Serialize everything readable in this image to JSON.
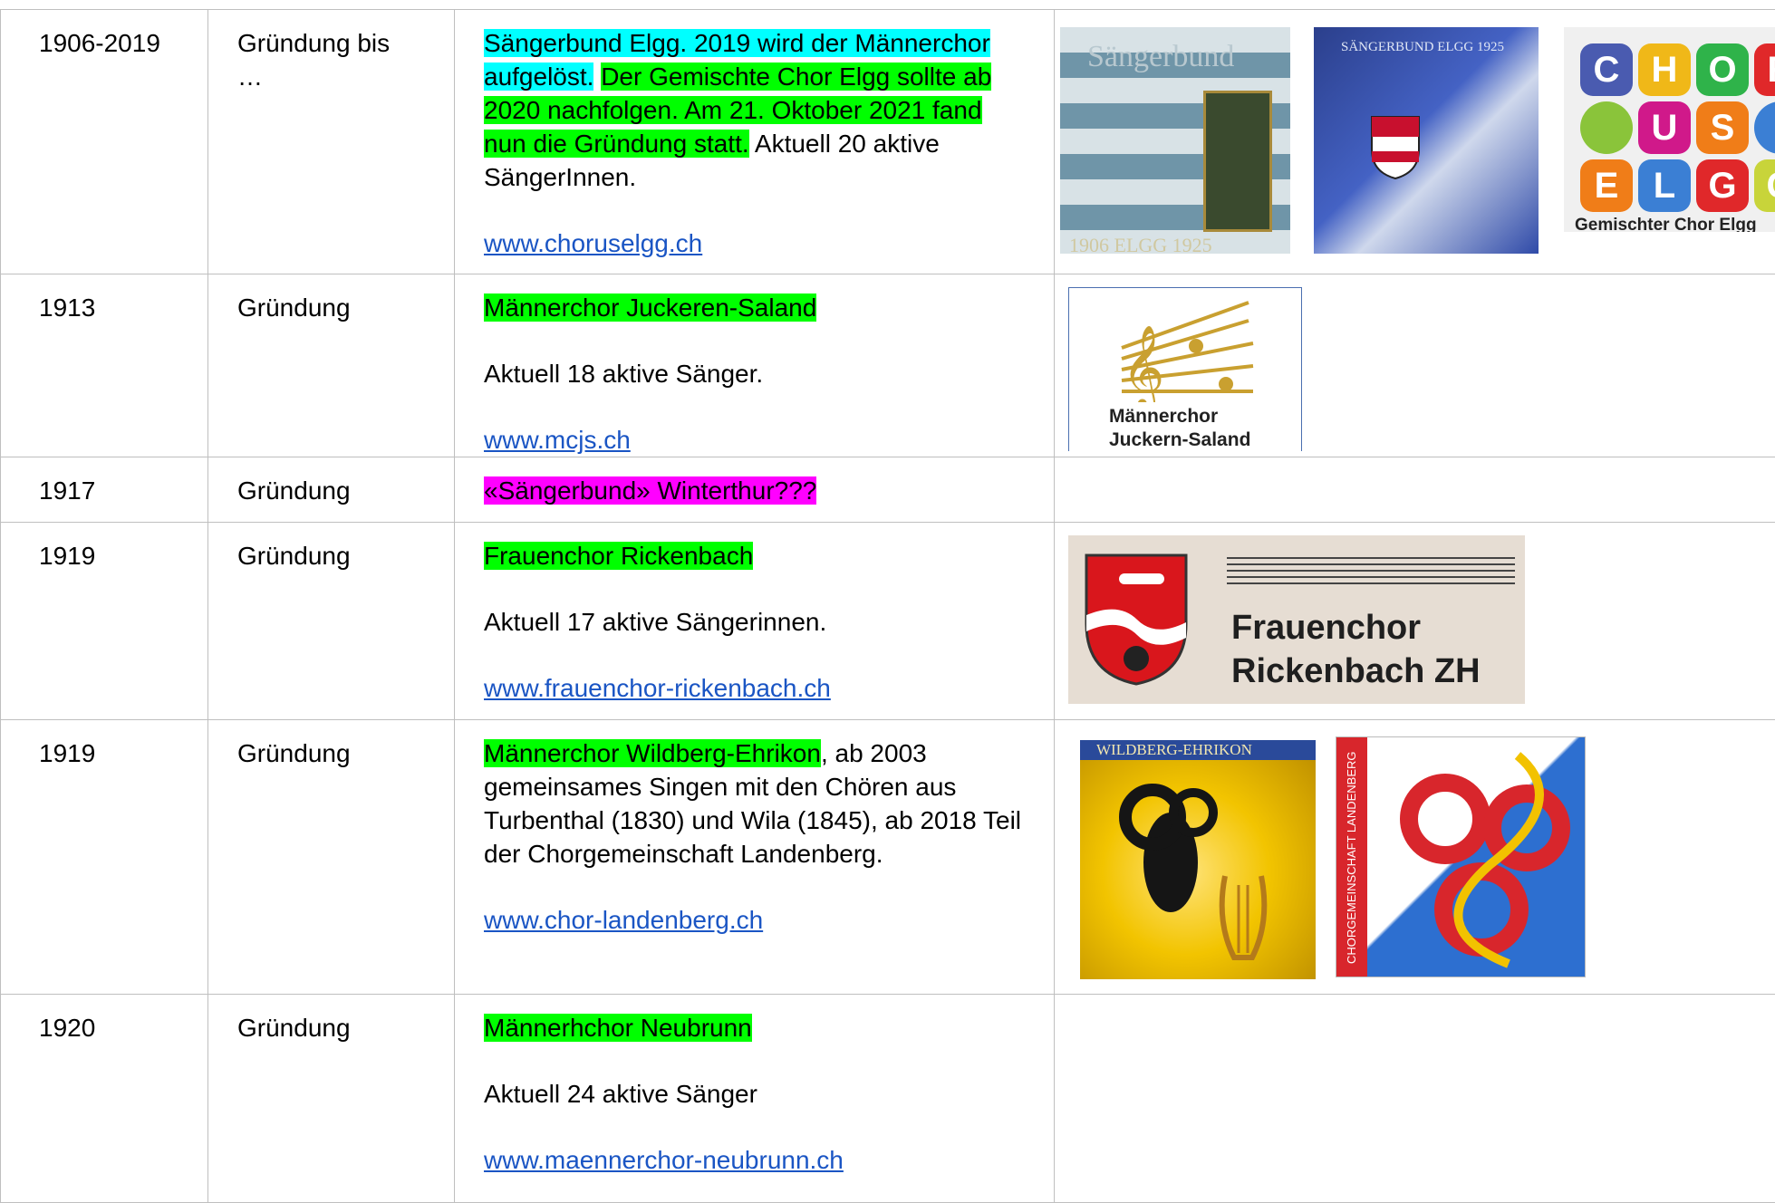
{
  "rows": [
    {
      "year": "1906-2019",
      "event": "Gründung bis …",
      "parts": [
        {
          "text": "Sängerbund Elgg. 2019 wird der Männerchor aufgelöst.",
          "hl": "cyan"
        },
        {
          "text": " ",
          "hl": ""
        },
        {
          "text": "Der Gemischte Chor Elgg sollte ab 2020 nachfolgen. Am 21. Oktober 2021 fand nun die Gründung statt.",
          "hl": "green"
        },
        {
          "text": " Aktuell 20 aktive SängerInnen.",
          "hl": ""
        }
      ],
      "link": "www.choruselgg.ch"
    },
    {
      "year": "1913",
      "event": "Gründung",
      "name": "Männerchor Juckeren-Saland",
      "detail": "Aktuell 18 aktive Sänger.",
      "link": "www.mcjs.ch",
      "logo_text": [
        "Männerchor",
        "Juckern-Saland"
      ]
    },
    {
      "year": "1917",
      "event": "Gründung",
      "name": "«Sängerbund» Winterthur???"
    },
    {
      "year": "1919",
      "event": "Gründung",
      "name": "Frauenchor Rickenbach",
      "detail": "Aktuell 17 aktive Sängerinnen.",
      "link": "www.frauenchor-rickenbach.ch",
      "logo_text": [
        "Frauenchor",
        "Rickenbach ZH"
      ]
    },
    {
      "year": "1919",
      "event": "Gründung",
      "name": "Männerchor Wildberg-Ehrikon",
      "rest": ", ab 2003 gemeinsames Singen mit den Chören aus Turbenthal (1830) und Wila (1845), ab 2018 Teil der Chorgemeinschaft Landenberg.",
      "link": "www.chor-landenberg.ch"
    },
    {
      "year": "1920",
      "event": "Gründung",
      "name": "Männerhchor Neubrunn",
      "detail": "Aktuell 24 aktive Sänger",
      "link": "www.maennerchor-neubrunn.ch"
    }
  ],
  "logos": {
    "choir_letters": [
      "C",
      "H",
      "O",
      "R",
      "U",
      "S",
      "E",
      "L",
      "G",
      "G"
    ],
    "choir_caption": "Gemischter Chor Elgg",
    "flag1_top": "Sängerbund",
    "flag1_bottom": "1906 ELGG 1925",
    "flag2_top": "SÄNGERBUND ELGG 1925",
    "flag3_top": "WILDBERG-EHRIKON",
    "landenberg_vertical": "CHORGEMEINSCHAFT LANDENBERG"
  },
  "colors": {
    "link": "#1a55c4",
    "cyan": "#00ffff",
    "green": "#00ff00",
    "magenta": "#ff00ff"
  }
}
